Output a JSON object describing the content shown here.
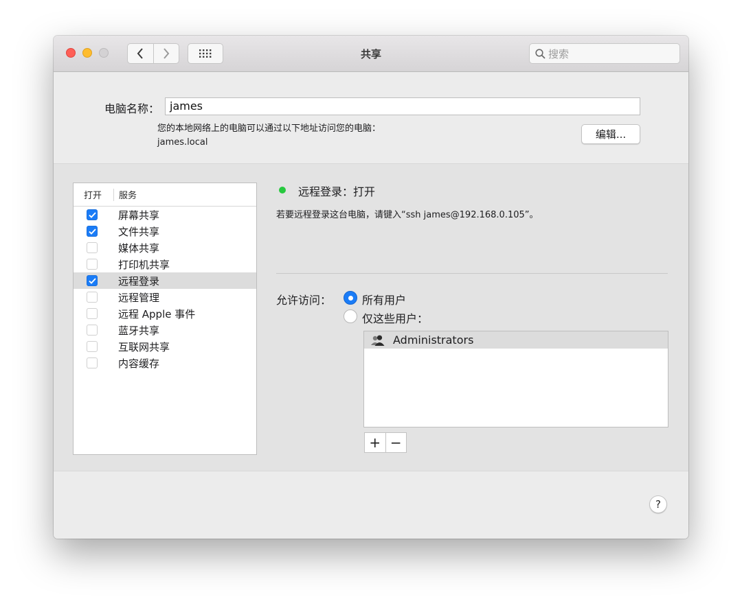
{
  "window": {
    "title": "共享",
    "search_placeholder": "搜索",
    "icons": {
      "back": "chevron-left-icon",
      "forward": "chevron-right-icon",
      "grid": "grid-icon",
      "search": "search-icon"
    }
  },
  "computer_name": {
    "label": "电脑名称：",
    "value": "james",
    "address_line1": "您的本地网络上的电脑可以通过以下地址访问您的电脑：",
    "address_line2": "james.local",
    "edit_label": "编辑..."
  },
  "services": {
    "header_on": "打开",
    "header_service": "服务",
    "items": [
      {
        "label": "屏幕共享",
        "checked": true,
        "selected": false
      },
      {
        "label": "文件共享",
        "checked": true,
        "selected": false
      },
      {
        "label": "媒体共享",
        "checked": false,
        "selected": false
      },
      {
        "label": "打印机共享",
        "checked": false,
        "selected": false
      },
      {
        "label": "远程登录",
        "checked": true,
        "selected": true
      },
      {
        "label": "远程管理",
        "checked": false,
        "selected": false
      },
      {
        "label": "远程 Apple 事件",
        "checked": false,
        "selected": false
      },
      {
        "label": "蓝牙共享",
        "checked": false,
        "selected": false
      },
      {
        "label": "互联网共享",
        "checked": false,
        "selected": false
      },
      {
        "label": "内容缓存",
        "checked": false,
        "selected": false
      }
    ]
  },
  "detail": {
    "status": "远程登录：打开",
    "status_color": "#27c93f",
    "hint": "若要远程登录这台电脑，请键入“ssh james@192.168.0.105”。",
    "access_label": "允许访问：",
    "radio_all": "所有用户",
    "radio_some": "仅这些用户：",
    "users": [
      "Administrators"
    ],
    "add_label": "+",
    "remove_label": "−"
  },
  "help_label": "?",
  "colors": {
    "accent": "#1a7cf7",
    "close": "#fe5f57",
    "minimize": "#febc2e"
  }
}
